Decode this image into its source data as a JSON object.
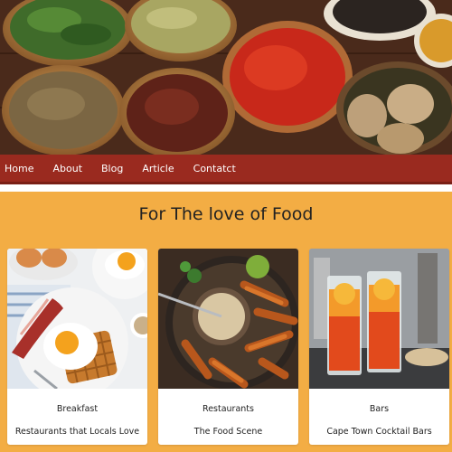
{
  "nav": {
    "items": [
      {
        "label": "Home"
      },
      {
        "label": "About"
      },
      {
        "label": "Blog"
      },
      {
        "label": "Article"
      },
      {
        "label": "Contatct"
      }
    ]
  },
  "main": {
    "heading": "For The love of Food",
    "cards": [
      {
        "title": "Breakfast",
        "subtitle": "Restaurants that Locals Love",
        "image": "breakfast-photo"
      },
      {
        "title": "Restaurants",
        "subtitle": "The Food Scene",
        "image": "fries-dip-photo"
      },
      {
        "title": "Bars",
        "subtitle": "Cape Town Cocktail Bars",
        "image": "cocktails-photo"
      }
    ]
  },
  "colors": {
    "page_background": "#f3ad44",
    "nav_background": "#9a2a1f",
    "card_background": "#ffffff"
  }
}
